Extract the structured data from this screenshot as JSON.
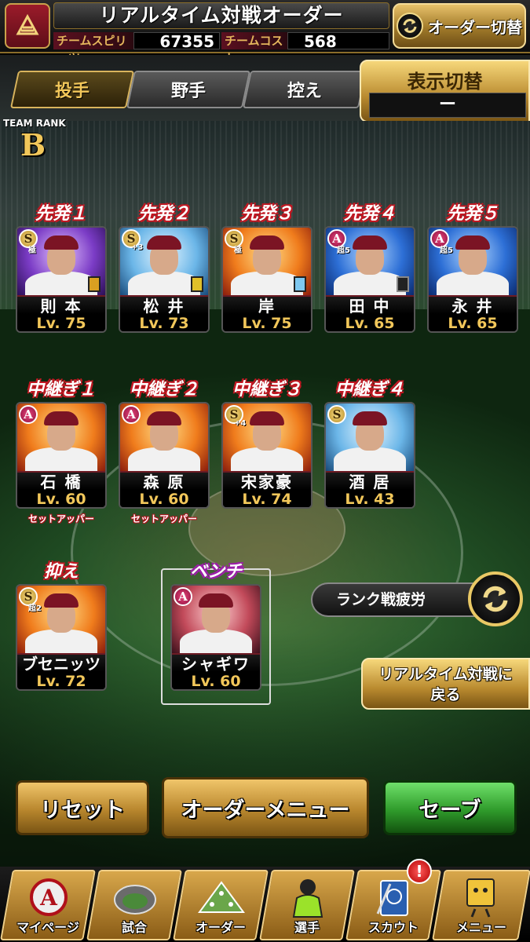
{
  "header": {
    "title": "リアルタイム対戦オーダー",
    "spirits_label": "チームスピリッツ",
    "spirits_value": "67355",
    "cost_label": "チームコスト",
    "cost_value": "568",
    "order_switch_label": "オーダー切替"
  },
  "tabs": [
    {
      "label": "投手",
      "active": true
    },
    {
      "label": "野手",
      "active": false
    },
    {
      "label": "控え",
      "active": false
    }
  ],
  "display_switch": {
    "label": "表示切替",
    "value": "ー"
  },
  "team_rank": {
    "label": "TEAM RANK",
    "value": "B"
  },
  "starters": [
    {
      "slot": "先発１",
      "name": "則 本",
      "level": "Lv. 75",
      "rarity": "S",
      "badge": "極",
      "chip_color": "#d9a021"
    },
    {
      "slot": "先発２",
      "name": "松 井",
      "level": "Lv. 73",
      "rarity": "S",
      "badge": "+3",
      "chip_color": "#e0c02a"
    },
    {
      "slot": "先発３",
      "name": "岸",
      "level": "Lv. 75",
      "rarity": "S",
      "badge": "極",
      "chip_color": "#7ec8f0"
    },
    {
      "slot": "先発４",
      "name": "田 中",
      "level": "Lv. 65",
      "rarity": "A",
      "badge": "超5",
      "chip_color": "#222222"
    },
    {
      "slot": "先発５",
      "name": "永 井",
      "level": "Lv. 65",
      "rarity": "A",
      "badge": "超5",
      "chip_color": ""
    }
  ],
  "relievers": [
    {
      "slot": "中継ぎ１",
      "name": "石 橋",
      "level": "Lv. 60",
      "rarity": "A",
      "badge": "",
      "note": "セットアッパー"
    },
    {
      "slot": "中継ぎ２",
      "name": "森 原",
      "level": "Lv. 60",
      "rarity": "A",
      "badge": "",
      "note": "セットアッパー"
    },
    {
      "slot": "中継ぎ３",
      "name": "宋家豪",
      "level": "Lv. 74",
      "rarity": "S",
      "badge": "+4",
      "note": ""
    },
    {
      "slot": "中継ぎ４",
      "name": "酒 居",
      "level": "Lv. 43",
      "rarity": "S",
      "badge": "",
      "note": ""
    }
  ],
  "closer": {
    "slot": "抑え",
    "name": "ブセニッツ",
    "level": "Lv. 72",
    "rarity": "S",
    "badge": "超2"
  },
  "bench": {
    "slot": "ベンチ",
    "name": "シャギワ",
    "level": "Lv. 60",
    "rarity": "A",
    "badge": ""
  },
  "side": {
    "fatigue_label": "ランク戦疲労",
    "back_label_line1": "リアルタイム対戦に",
    "back_label_line2": "戻る"
  },
  "actions": {
    "reset": "リセット",
    "order_menu": "オーダーメニュー",
    "save": "セーブ"
  },
  "nav": [
    {
      "label": "マイページ",
      "icon": "mypage-icon"
    },
    {
      "label": "試合",
      "icon": "game-icon"
    },
    {
      "label": "オーダー",
      "icon": "order-icon"
    },
    {
      "label": "選手",
      "icon": "player-icon"
    },
    {
      "label": "スカウト",
      "icon": "scout-icon"
    },
    {
      "label": "メニュー",
      "icon": "menu-icon"
    }
  ],
  "notify_badge": "!",
  "colors": {
    "accent_gold": "#f2c75a",
    "team_red": "#7b1424",
    "save_green": "#2f9b2b"
  }
}
